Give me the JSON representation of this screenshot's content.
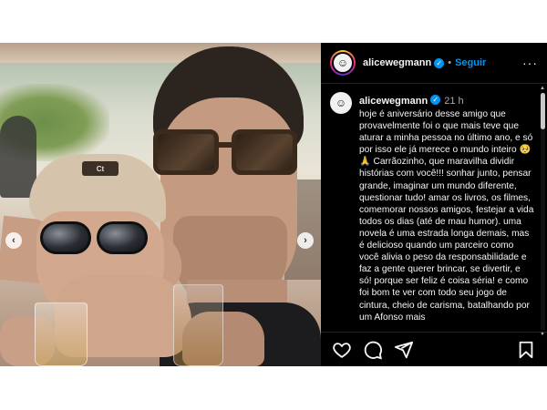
{
  "post": {
    "author": {
      "username": "alicewegmann",
      "avatar_icon": "avatar-icon",
      "verified_icon": "verified-badge-icon",
      "follow_label": "Seguir",
      "more_icon": "more-options-icon"
    },
    "photo": {
      "cap_patch_text": "Ct",
      "prev_icon": "chevron-left-icon",
      "next_icon": "chevron-right-icon"
    },
    "caption": {
      "username": "alicewegmann",
      "time": "21 h",
      "text": "hoje é aniversário desse amigo que provavelmente foi o que mais teve que aturar a minha pessoa no último ano, e só por isso ele já merece o mundo inteiro 🥺🙏 Carrãozinho, que maravilha dividir histórias com você!!! sonhar junto, pensar grande, imaginar um mundo diferente, questionar tudo! amar os livros, os filmes, comemorar nossos amigos, festejar a vida todos os dias (até de mau humor). uma novela é uma estrada longa demais, mas é delicioso quando um parceiro como você alivia o peso da responsabilidade e faz a gente querer brincar, se divertir, e só! porque ser feliz é coisa séria! e como foi bom te ver com todo seu jogo de cintura, cheio de carisma, batalhando por um Afonso mais"
    },
    "actions": {
      "icons": [
        "heart-icon",
        "comment-icon",
        "share-icon",
        "bookmark-icon"
      ]
    },
    "colors": {
      "background": "#000000",
      "text": "#f5f5f5",
      "accent": "#0095f6",
      "muted": "#a8a8a8"
    }
  }
}
